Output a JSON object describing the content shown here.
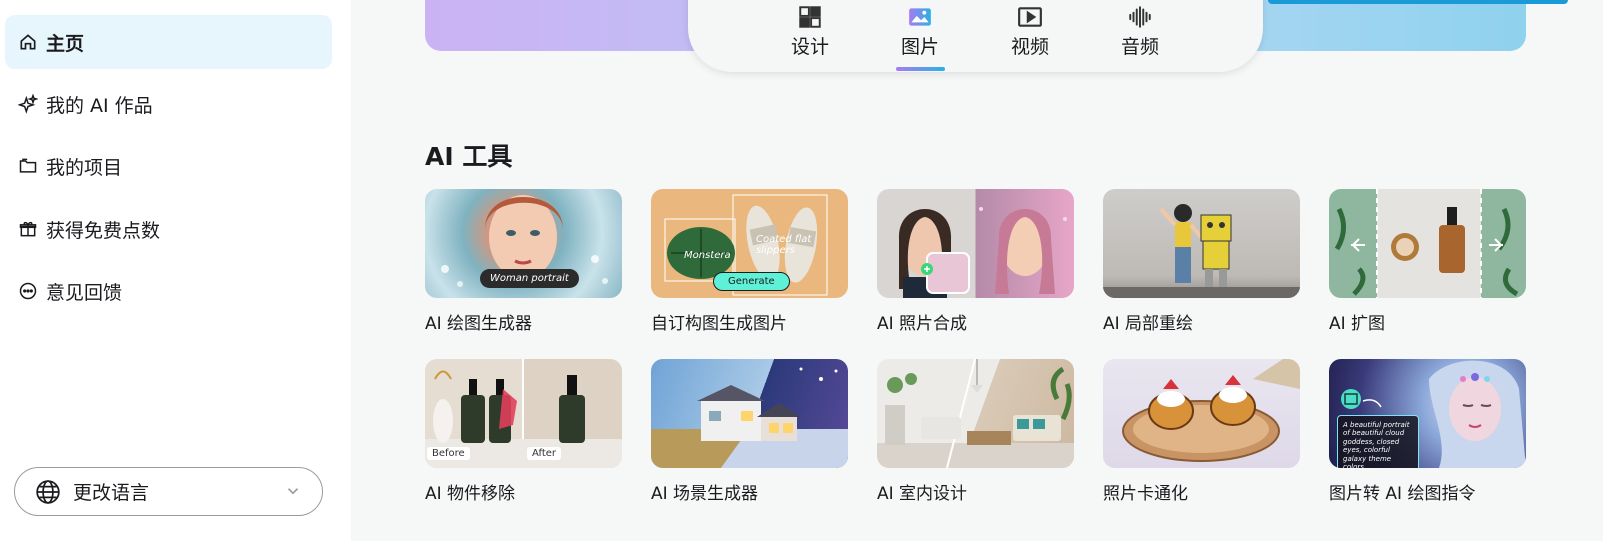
{
  "sidebar": {
    "items": [
      {
        "label": "主页",
        "icon": "home-icon",
        "active": true
      },
      {
        "label": "我的 AI 作品",
        "icon": "sparkle-icon",
        "active": false
      },
      {
        "label": "我的项目",
        "icon": "folder-icon",
        "active": false
      },
      {
        "label": "获得免费点数",
        "icon": "gift-icon",
        "active": false
      },
      {
        "label": "意见回馈",
        "icon": "chat-bubble-icon",
        "active": false
      }
    ],
    "language_button": "更改语言"
  },
  "tabs": [
    {
      "label": "设计",
      "icon": "layout-icon",
      "active": false
    },
    {
      "label": "图片",
      "icon": "image-icon",
      "active": true
    },
    {
      "label": "视频",
      "icon": "play-icon",
      "active": false
    },
    {
      "label": "音频",
      "icon": "audio-wave-icon",
      "active": false
    }
  ],
  "section": {
    "title": "AI 工具",
    "cards": [
      {
        "label": "AI 绘图生成器",
        "overlay_text": "Woman portrait"
      },
      {
        "label": "自订构图生成图片",
        "overlay_text": "Coated flat slippers",
        "overlay_text_2": "Monstera",
        "button_text": "Generate"
      },
      {
        "label": "AI 照片合成"
      },
      {
        "label": "AI 局部重绘"
      },
      {
        "label": "AI 扩图"
      },
      {
        "label": "AI 物件移除",
        "before_text": "Before",
        "after_text": "After"
      },
      {
        "label": "AI 场景生成器"
      },
      {
        "label": "AI 室内设计"
      },
      {
        "label": "照片卡通化"
      },
      {
        "label": "图片转 AI 绘图指令",
        "overlay_text": "A beautiful portrait of beautiful cloud goddess, closed eyes, colorful galaxy theme colors..."
      }
    ]
  },
  "colors": {
    "accent": "#1a9ad6",
    "active_nav_bg": "#e6f6fc",
    "tab_underline_start": "#a67cf0",
    "tab_underline_end": "#2ab0e6"
  }
}
